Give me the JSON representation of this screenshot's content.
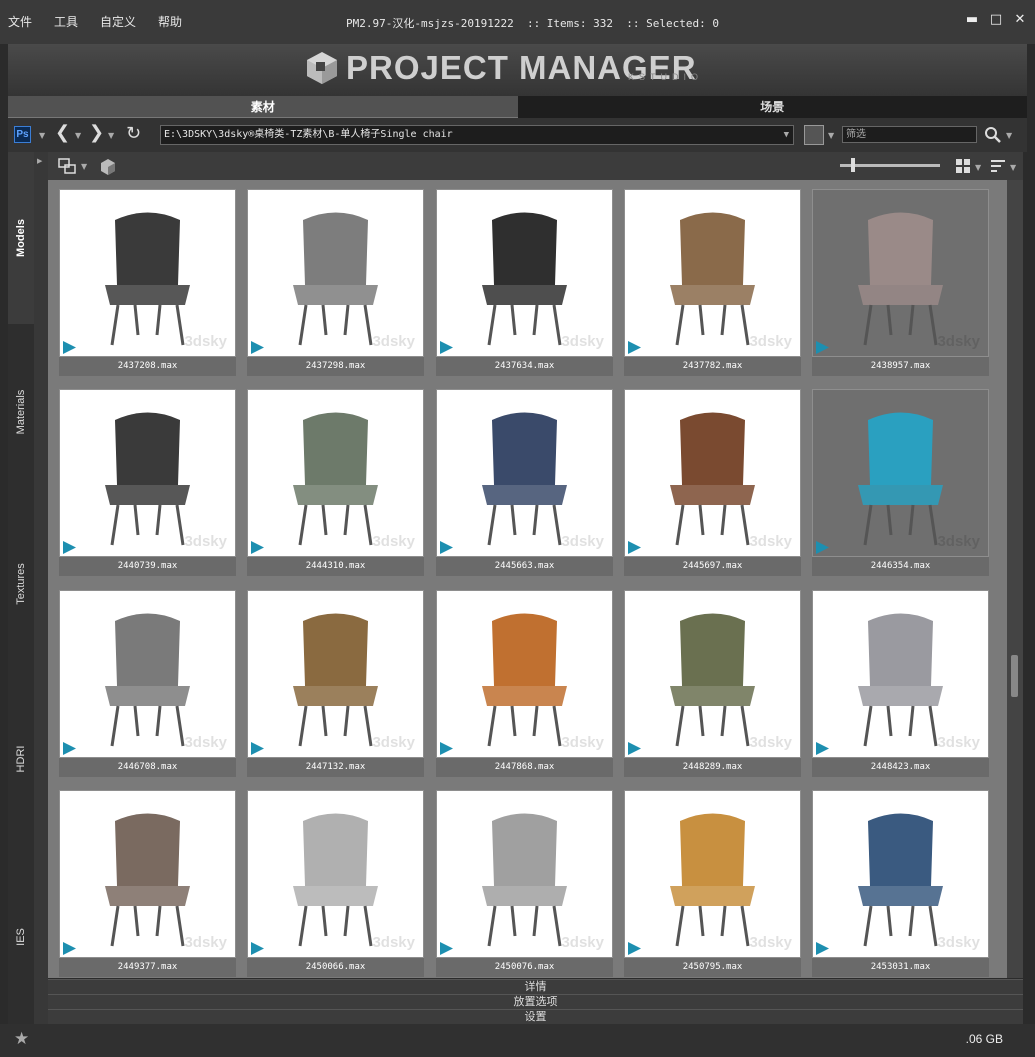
{
  "menu": [
    "文件",
    "工具",
    "自定义",
    "帮助"
  ],
  "window_title": "PM2.97-汉化-msjzs-20191222  :: Items: 332  :: Selected: 0",
  "window_buttons": [
    "minimize-icon",
    "maximize-icon",
    "close-icon"
  ],
  "banner": {
    "logo_text": "PROJECT MANAGER",
    "logo_sub": "KSTUDIO"
  },
  "tabs": [
    {
      "label": "素材",
      "active": true
    },
    {
      "label": "场景",
      "active": false
    }
  ],
  "toolbar": {
    "ps_label": "Ps",
    "path": "E:\\3DSKY\\3dsky®桌椅类-TZ素材\\B-单人椅子Single chair",
    "filter_placeholder": "筛选"
  },
  "side_tabs": [
    {
      "label": "Models",
      "active": true
    },
    {
      "label": "Materials",
      "active": false
    },
    {
      "label": "Textures",
      "active": false
    },
    {
      "label": "HDRI",
      "active": false
    },
    {
      "label": "IES",
      "active": false
    }
  ],
  "items": [
    {
      "name": "2437208.max",
      "tone": "light"
    },
    {
      "name": "2437298.max",
      "tone": "light"
    },
    {
      "name": "2437634.max",
      "tone": "light"
    },
    {
      "name": "2437782.max",
      "tone": "light"
    },
    {
      "name": "2438957.max",
      "tone": "dark"
    },
    {
      "name": "2440739.max",
      "tone": "light"
    },
    {
      "name": "2444310.max",
      "tone": "light"
    },
    {
      "name": "2445663.max",
      "tone": "light"
    },
    {
      "name": "2445697.max",
      "tone": "light"
    },
    {
      "name": "2446354.max",
      "tone": "dark"
    },
    {
      "name": "2446708.max",
      "tone": "light"
    },
    {
      "name": "2447132.max",
      "tone": "light"
    },
    {
      "name": "2447868.max",
      "tone": "light"
    },
    {
      "name": "2448289.max",
      "tone": "light"
    },
    {
      "name": "2448423.max",
      "tone": "light"
    },
    {
      "name": "2449377.max",
      "tone": "light"
    },
    {
      "name": "2450066.max",
      "tone": "light"
    },
    {
      "name": "2450076.max",
      "tone": "light"
    },
    {
      "name": "2450795.max",
      "tone": "light"
    },
    {
      "name": "2453031.max",
      "tone": "light"
    }
  ],
  "watermark": "3dsky",
  "sections": [
    "详情",
    "放置选项",
    "设置"
  ],
  "status": {
    "disk": ".06 GB"
  },
  "colors": {
    "accent_blue": "#1d8fb0",
    "background": "#2b2b2b"
  }
}
